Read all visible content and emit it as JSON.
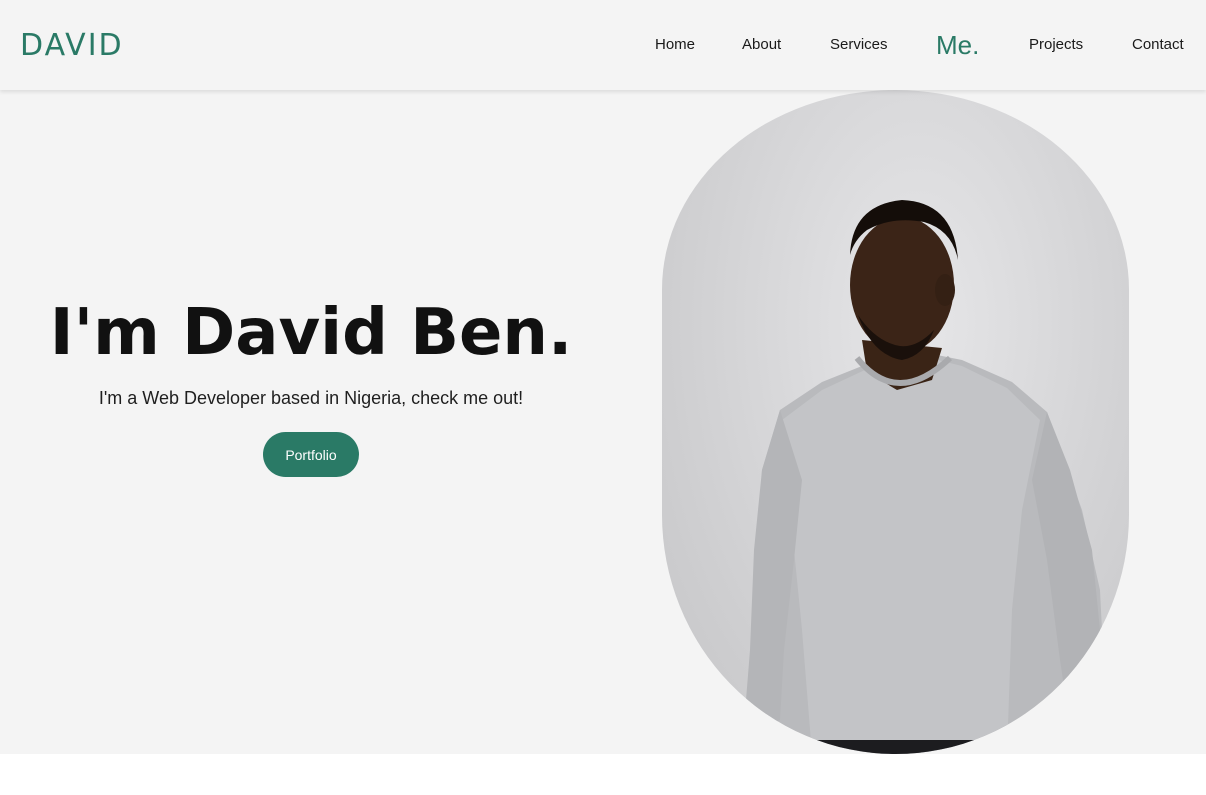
{
  "nav": {
    "brand": "DAVID",
    "links": {
      "home": "Home",
      "about": "About",
      "services": "Services",
      "me": "Me.",
      "projects": "Projects",
      "contact": "Contact"
    }
  },
  "hero": {
    "title": "I'm David Ben.",
    "subtitle": "I'm a Web Developer based in Nigeria, check me out!",
    "button_label": "Portfolio"
  },
  "colors": {
    "accent": "#2a7a66",
    "background": "#f4f4f4"
  }
}
